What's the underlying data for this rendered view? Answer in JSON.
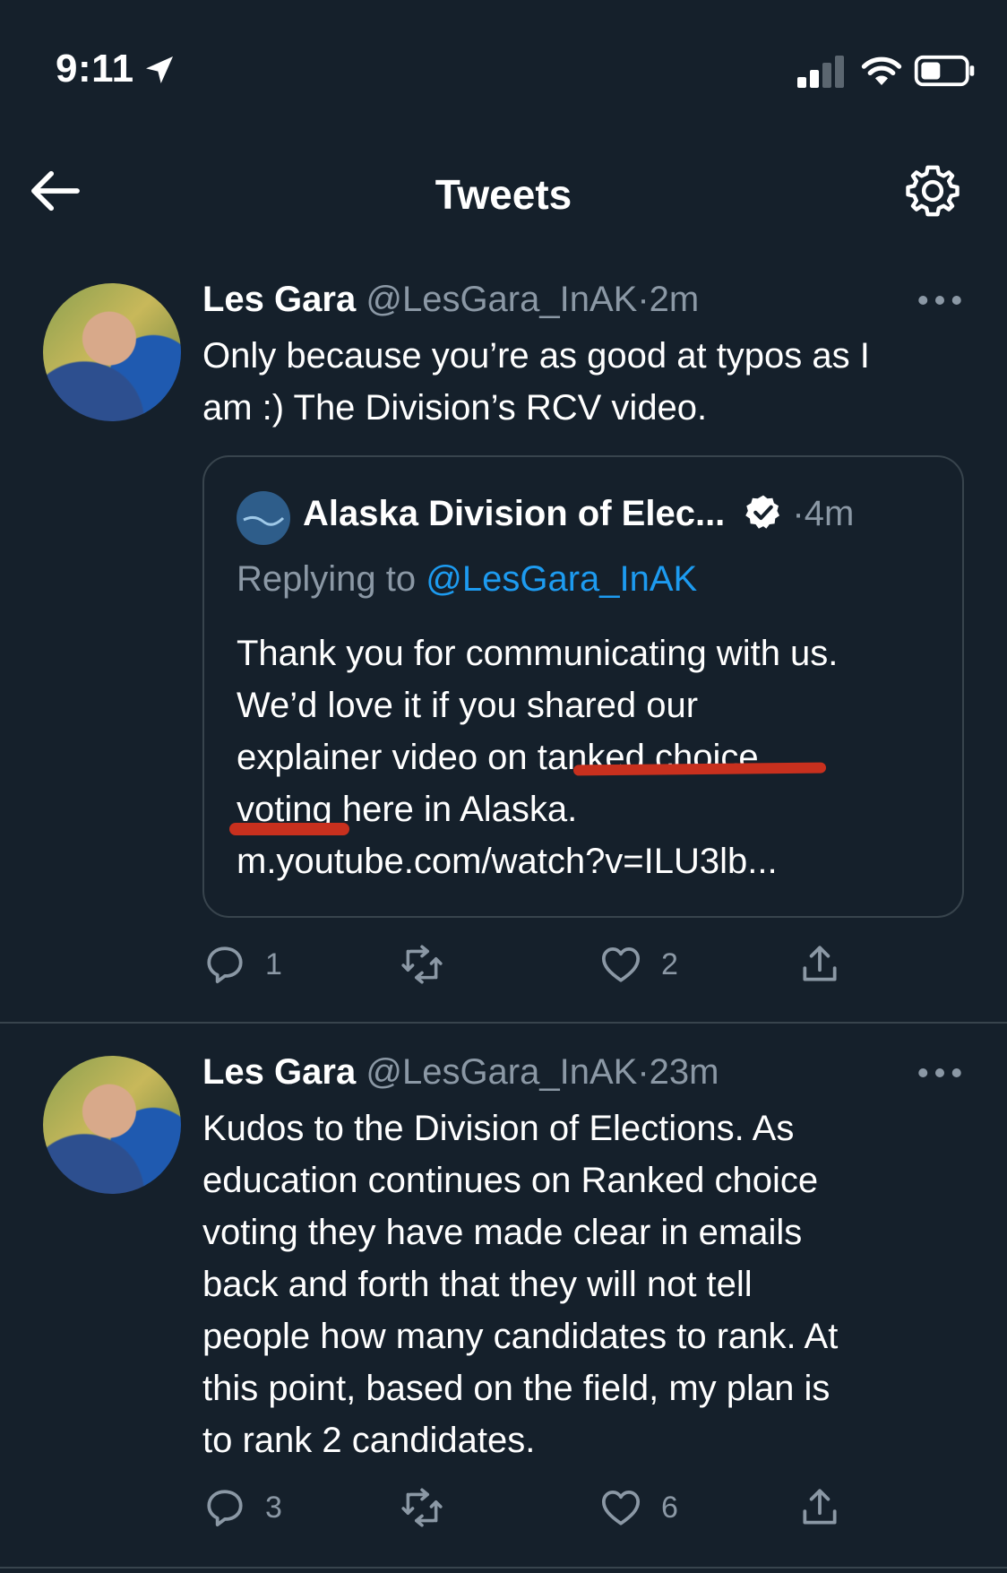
{
  "status_bar": {
    "time": "9:11"
  },
  "header": {
    "title": "Tweets"
  },
  "tweets": [
    {
      "name": "Les Gara",
      "handle": "@LesGara_InAK",
      "separator": "·",
      "ago": "2m",
      "text": "Only because you’re as good at typos as I\nam :) The Division’s RCV video.",
      "quote": {
        "name": "Alaska Division of Elec...",
        "separator": "·",
        "ago": "4m",
        "replying_prefix": "Replying to",
        "replying_handle": "@LesGara_InAK",
        "text": "Thank you for communicating with us.\nWe’d love it if you shared our\nexplainer video on tanked choice\nvoting here in Alaska.\nm.youtube.com/watch?v=ILU3lb..."
      },
      "actions": {
        "replies": "1",
        "retweets": "",
        "likes": "2"
      }
    },
    {
      "name": "Les Gara",
      "handle": "@LesGara_InAK",
      "separator": "·",
      "ago": "23m",
      "text": "Kudos to the Division of Elections. As\neducation continues on Ranked choice\nvoting they have made clear in emails\nback and forth that they will not tell\npeople how many candidates to rank. At\nthis point, based on the field, my plan is\nto rank 2 candidates.",
      "actions": {
        "replies": "3",
        "retweets": "",
        "likes": "6"
      }
    }
  ],
  "colors": {
    "background": "#15202b",
    "secondary_text": "#8b98a5",
    "link": "#1d9bf0",
    "border": "#38444d",
    "annotation_underline": "#c8301e"
  },
  "icons": [
    "location-arrow-icon",
    "signal-icon",
    "wifi-icon",
    "battery-icon",
    "back-arrow-icon",
    "gear-icon",
    "more-icon",
    "verified-icon",
    "reply-icon",
    "retweet-icon",
    "like-icon",
    "share-icon"
  ]
}
